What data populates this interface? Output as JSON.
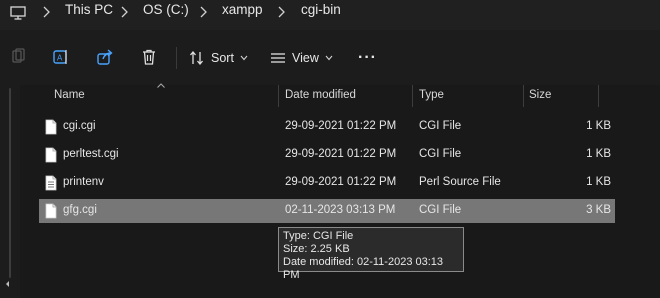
{
  "breadcrumb": {
    "items": [
      "This PC",
      "OS (C:)",
      "xampp",
      "cgi-bin"
    ]
  },
  "toolbar": {
    "sort_label": "Sort",
    "view_label": "View",
    "more_label": "···"
  },
  "columns": {
    "name": "Name",
    "date": "Date modified",
    "type": "Type",
    "size": "Size"
  },
  "files": [
    {
      "name": "cgi.cgi",
      "date": "29-09-2021 01:22 PM",
      "type": "CGI File",
      "size": "1 KB"
    },
    {
      "name": "perltest.cgi",
      "date": "29-09-2021 01:22 PM",
      "type": "CGI File",
      "size": "1 KB"
    },
    {
      "name": "printenv",
      "date": "29-09-2021 01:22 PM",
      "type": "Perl Source File",
      "size": "1 KB"
    },
    {
      "name": "gfg.cgi",
      "date": "02-11-2023 03:13 PM",
      "type": "CGI File",
      "size": "3 KB"
    }
  ],
  "selected_index": 3,
  "tooltip": {
    "type_line": "Type: CGI File",
    "size_line": "Size: 2.25 KB",
    "date_line": "Date modified: 02-11-2023 03:13 PM"
  },
  "colors": {
    "background": "#191919",
    "selection": "#777777",
    "text": "#e6e6e6",
    "accent_blue": "#4aa3ff"
  }
}
